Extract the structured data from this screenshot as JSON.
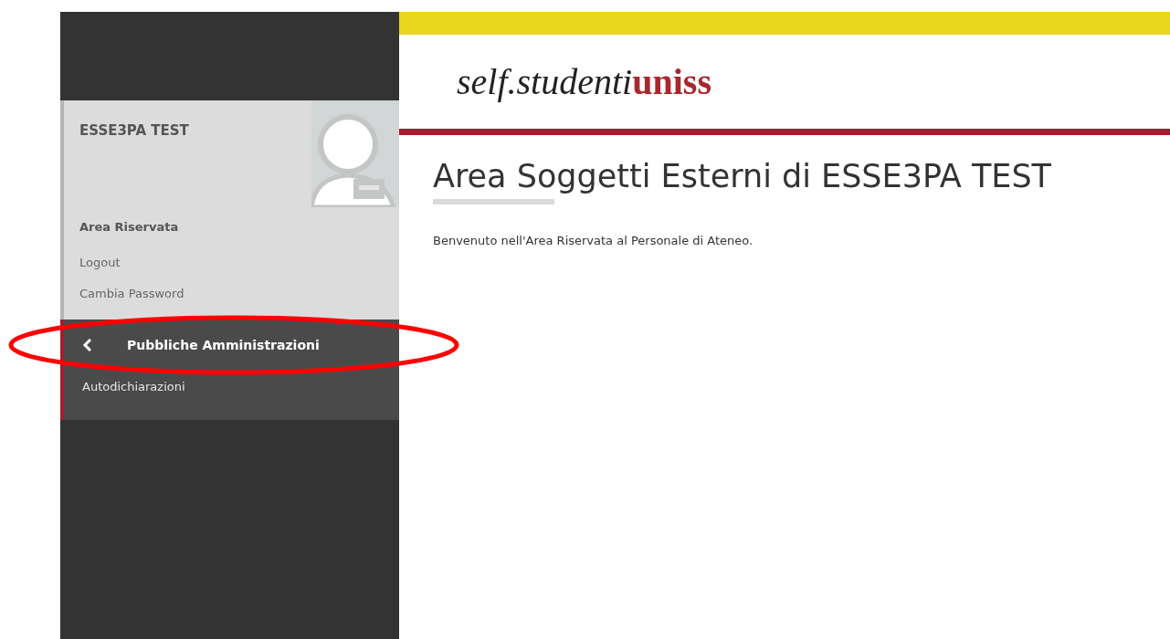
{
  "user_panel": {
    "name": "ESSE3PA TEST",
    "section_title": "Area Riservata",
    "links": [
      "Logout",
      "Cambia Password"
    ]
  },
  "menu": {
    "title": "Pubbliche Amministrazioni",
    "items": [
      "Autodichiarazioni"
    ]
  },
  "annotation": {
    "kind": "ellipse",
    "color": "#ff0000"
  },
  "header": {
    "logo_main": "self.studenti",
    "logo_accent": "uniss"
  },
  "page": {
    "title": "Area Soggetti Esterni di ESSE3PA TEST",
    "intro": "Benvenuto nell'Area Riservata al Personale di Ateneo."
  }
}
